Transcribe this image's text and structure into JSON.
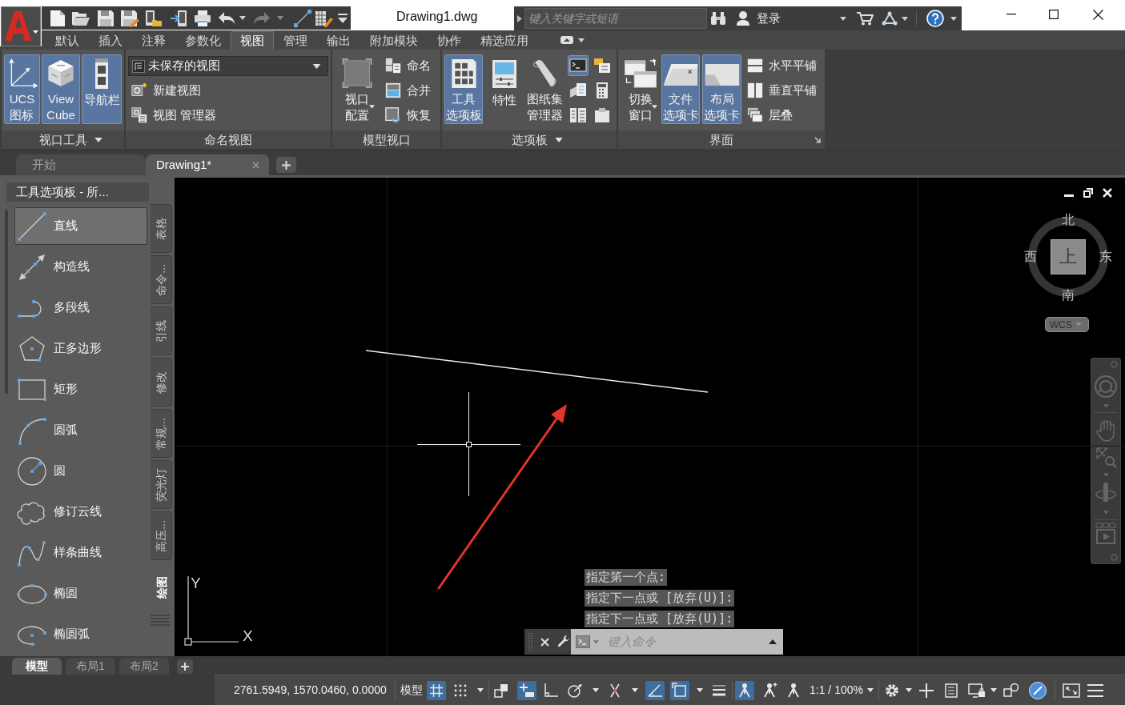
{
  "title_bar": {
    "title": "Drawing1.dwg",
    "search": {
      "placeholder": "键入关键字或短语"
    },
    "sign_in": "登录"
  },
  "ribbon_tabs": [
    {
      "label": "默认",
      "selected": false
    },
    {
      "label": "插入",
      "selected": false
    },
    {
      "label": "注释",
      "selected": false
    },
    {
      "label": "参数化",
      "selected": false
    },
    {
      "label": "视图",
      "selected": true
    },
    {
      "label": "管理",
      "selected": false
    },
    {
      "label": "输出",
      "selected": false
    },
    {
      "label": "附加模块",
      "selected": false
    },
    {
      "label": "协作",
      "selected": false
    },
    {
      "label": "精选应用",
      "selected": false
    }
  ],
  "ribbon": {
    "viewport_tools": {
      "title": "视口工具",
      "buttons": [
        {
          "lines": [
            "UCS",
            "图标"
          ],
          "on": true
        },
        {
          "lines": [
            "View",
            "Cube"
          ],
          "on": true
        },
        {
          "lines": [
            "导航栏"
          ],
          "on": true
        }
      ]
    },
    "named_views": {
      "title": "命名视图",
      "current_view": "未保存的视图",
      "buttons": [
        "新建视图",
        "视图 管理器"
      ]
    },
    "model_viewports": {
      "title": "模型视口",
      "config_button": [
        "视口",
        "配置"
      ],
      "buttons": [
        "命名",
        "合并",
        "恢复"
      ]
    },
    "palettes": {
      "title": "选项板",
      "buttons": [
        {
          "lines": [
            "工具",
            "选项板"
          ],
          "on": true
        },
        {
          "lines": [
            "特性"
          ],
          "on": false
        },
        {
          "lines": [
            "图纸集",
            "管理器"
          ],
          "on": false
        }
      ],
      "small_buttons": [
        {
          "on": true
        },
        {
          "on": false
        },
        {
          "on": false
        },
        {
          "on": false
        },
        {
          "on": false
        },
        {
          "on": false
        }
      ]
    },
    "interface": {
      "title": "界面",
      "buttons": [
        {
          "lines": [
            "切换",
            "窗口"
          ],
          "on": false
        },
        {
          "lines": [
            "文件",
            "选项卡"
          ],
          "on": true
        },
        {
          "lines": [
            "布局",
            "选项卡"
          ],
          "on": true
        }
      ],
      "small_buttons": [
        "水平平铺",
        "垂直平铺",
        "层叠"
      ]
    }
  },
  "file_tabs": [
    {
      "label": "开始",
      "selected": false
    },
    {
      "label": "Drawing1*",
      "selected": true
    }
  ],
  "tool_palette": {
    "title": "工具选项板 - 所...",
    "items": [
      {
        "label": "直线",
        "selected": true
      },
      {
        "label": "构造线",
        "selected": false
      },
      {
        "label": "多段线",
        "selected": false
      },
      {
        "label": "正多边形",
        "selected": false
      },
      {
        "label": "矩形",
        "selected": false
      },
      {
        "label": "圆弧",
        "selected": false
      },
      {
        "label": "圆",
        "selected": false
      },
      {
        "label": "修订云线",
        "selected": false
      },
      {
        "label": "样条曲线",
        "selected": false
      },
      {
        "label": "椭圆",
        "selected": false
      },
      {
        "label": "椭圆弧",
        "selected": false
      }
    ],
    "side_tabs": [
      {
        "label": "表格",
        "selected": false
      },
      {
        "label": "命令...",
        "selected": false
      },
      {
        "label": "引线",
        "selected": false
      },
      {
        "label": "修改",
        "selected": false
      },
      {
        "label": "常规...",
        "selected": false
      },
      {
        "label": "荧光灯",
        "selected": false
      },
      {
        "label": "高压...",
        "selected": false
      },
      {
        "label": "绘图",
        "selected": true
      }
    ]
  },
  "canvas": {
    "ucs_icon": {
      "x_label": "X",
      "y_label": "Y"
    },
    "viewcube": {
      "north": "北",
      "south": "南",
      "west": "西",
      "east": "东",
      "face": "上",
      "coordinate_system": "WCS"
    },
    "command_history": [
      "指定第一个点:",
      "指定下一点或 [放弃(U)]:",
      "指定下一点或 [放弃(U)]:"
    ],
    "command_line": {
      "placeholder": "键入命令"
    }
  },
  "layout_tabs": [
    {
      "label": "模型",
      "selected": true
    },
    {
      "label": "布局1",
      "selected": false
    },
    {
      "label": "布局2",
      "selected": false
    }
  ],
  "status_bar": {
    "coordinates": "2761.5949, 1570.0460, 0.0000",
    "space": "模型",
    "toggles": [
      {
        "on": true
      },
      {
        "on": false
      },
      {
        "on": false
      },
      {
        "on": true
      },
      {
        "on": false
      },
      {
        "on": false
      },
      {
        "on": false
      },
      {
        "on": true
      },
      {
        "on": true
      },
      {
        "on": false
      },
      {
        "on": true
      },
      {
        "on": false
      },
      {
        "on": false
      },
      {
        "on": false
      },
      {
        "on": false
      },
      {
        "on": true
      }
    ],
    "annotation_scale": "1:1 / 100%"
  }
}
